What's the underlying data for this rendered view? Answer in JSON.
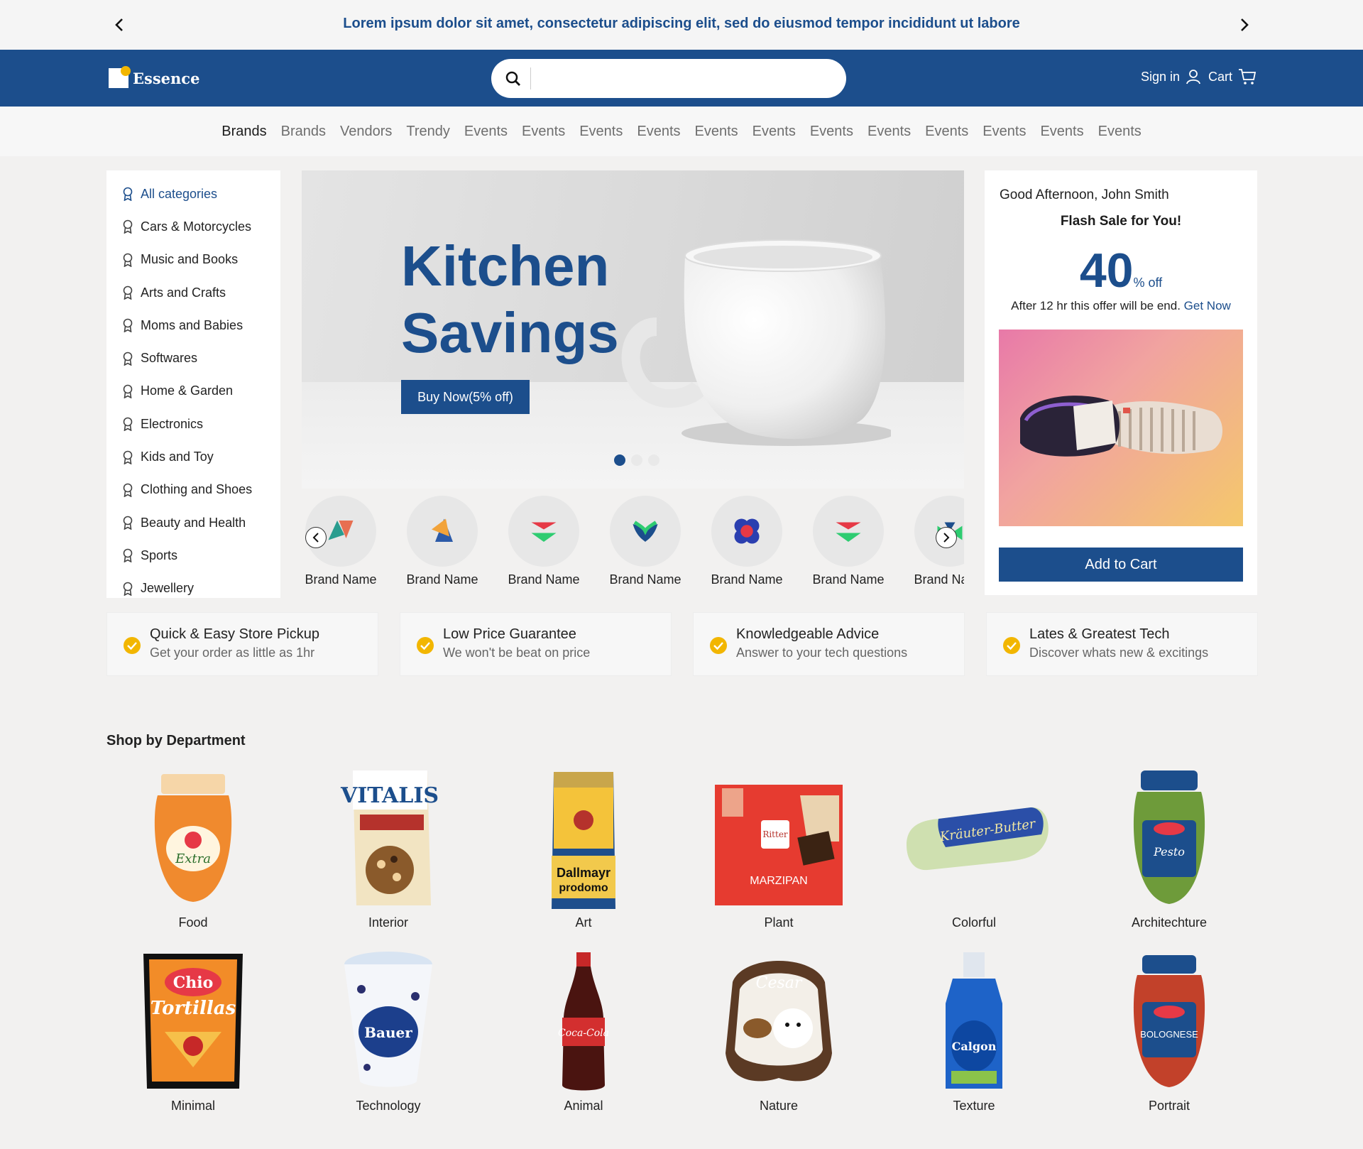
{
  "announcement": {
    "text": "Lorem ipsum dolor sit amet, consectetur adipiscing elit, sed do eiusmod tempor incididunt ut labore"
  },
  "header": {
    "logo_text": "Essence",
    "search_value": "",
    "sign_in": "Sign in",
    "cart": "Cart"
  },
  "nav": {
    "items": [
      "Brands",
      "Brands",
      "Vendors",
      "Trendy",
      "Events",
      "Events",
      "Events",
      "Events",
      "Events",
      "Events",
      "Events",
      "Events",
      "Events",
      "Events",
      "Events",
      "Events"
    ],
    "active_index": 0
  },
  "sidebar": {
    "items": [
      "All categories",
      "Cars & Motorcycles",
      "Music and Books",
      "Arts and Crafts",
      "Moms and Babies",
      "Softwares",
      "Home & Garden",
      "Electronics",
      "Kids and Toy",
      "Clothing and Shoes",
      "Beauty and Health",
      "Sports",
      "Jewellery"
    ],
    "active_index": 0
  },
  "hero": {
    "title_line1": "Kitchen",
    "title_line2": "Savings",
    "button": "Buy Now(5% off)",
    "slide_count": 3,
    "active_slide": 0
  },
  "brands": {
    "items": [
      "Brand Name",
      "Brand Name",
      "Brand Name",
      "Brand Name",
      "Brand Name",
      "Brand Name",
      "Brand Name"
    ]
  },
  "flash": {
    "greeting": "Good Afternoon, John Smith",
    "title": "Flash Sale for You!",
    "percent": "40",
    "percent_suffix": "% off",
    "after_text": "After 12 hr this offer will be end.",
    "get_now": "Get Now",
    "add_to_cart": "Add to Cart"
  },
  "features": [
    {
      "title": "Quick & Easy Store Pickup",
      "subtitle": "Get your order as little as 1hr"
    },
    {
      "title": "Low Price Guarantee",
      "subtitle": "We won't be beat on price"
    },
    {
      "title": "Knowledgeable Advice",
      "subtitle": "Answer to your tech questions"
    },
    {
      "title": "Lates & Greatest Tech",
      "subtitle": "Discover whats new & excitings"
    }
  ],
  "departments": {
    "title": "Shop by Department",
    "items": [
      {
        "label": "Food"
      },
      {
        "label": "Interior"
      },
      {
        "label": "Art"
      },
      {
        "label": "Plant"
      },
      {
        "label": "Colorful"
      },
      {
        "label": "Architechture"
      },
      {
        "label": "Minimal"
      },
      {
        "label": "Technology"
      },
      {
        "label": "Animal"
      },
      {
        "label": "Nature"
      },
      {
        "label": "Texture"
      },
      {
        "label": "Portrait"
      }
    ]
  },
  "colors": {
    "brand_blue": "#1c4e8c",
    "accent_yellow": "#f2b600",
    "page_bg": "#f2f1f0"
  }
}
